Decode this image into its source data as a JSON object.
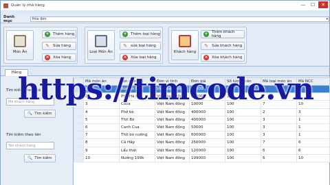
{
  "window": {
    "title": "Quản lý nhà hàng",
    "min": "—",
    "max": "☐",
    "close": "✕"
  },
  "menu": {
    "label": "Danh mục",
    "combo_value": "Hóa đơn",
    "combo_arrow": "▾"
  },
  "ribbon": {
    "groups": [
      {
        "big": "Món Ăn",
        "buttons": [
          "Thêm hàng",
          "Sửa hàng",
          "Xóa hàng"
        ]
      },
      {
        "big": "Loại Món Ăn",
        "buttons": [
          "Thêm loại hàng",
          "sửa loại hàng",
          "Xóa loại hàng"
        ]
      },
      {
        "big": "Khách hàng",
        "buttons": [
          "Thêm khách hàng",
          "Sửa khách hàng",
          "Xóa khách hàng"
        ]
      }
    ],
    "icons": {
      "add": "+",
      "edit": "✎",
      "del": "×"
    }
  },
  "tab": {
    "label": "Hàng"
  },
  "left": {
    "label1": "Tìm kiếm theo mã",
    "placeholder1": "Mã khách hàng",
    "search1": "Tìm kiếm",
    "label2": "Tìm kiếm theo tên",
    "placeholder2": "Tên khách hàng",
    "search2": "Tìm kiếm"
  },
  "table": {
    "columns": [
      "Mã món ăn",
      "Tên món ăn",
      "Đơn vị tính",
      "Đơn giá",
      "Số lượng còn",
      "Mã loại món ăn",
      "Mã NCC"
    ],
    "rows": [
      [
        "1",
        "Bún bò Huế",
        "Việt Nam đồng",
        "30000",
        "100",
        "7",
        "1"
      ],
      [
        "2",
        "Phở Hà Nội",
        "Việt Nam đồng",
        "25000",
        "100",
        "7",
        "5"
      ],
      [
        "3",
        "Coca",
        "Việt Nam đồng",
        "10000",
        "100",
        "7",
        "10"
      ],
      [
        "4",
        "Phở bò",
        "Việt Nam đồng",
        "400000",
        "100",
        "2",
        "3"
      ],
      [
        "5",
        "Thịt Bò",
        "Việt Nam đồng",
        "400000",
        "100",
        "3",
        "1"
      ],
      [
        "6",
        "Canh Cua",
        "Việt Nam đồng",
        "50000",
        "100",
        "3",
        "1"
      ],
      [
        "7",
        "Thịt bò nướng",
        "Việt Nam đồng",
        "600000",
        "100",
        "3",
        "1"
      ],
      [
        "8",
        "Cá Hấp",
        "Việt Nam đồng",
        "250000",
        "100",
        "7",
        "6"
      ],
      [
        "9",
        "Lẩu thái",
        "Việt Nam đồng",
        "120000",
        "100",
        "6",
        "6"
      ],
      [
        "10",
        "Nướng 199k",
        "Việt Nam đồng",
        "199000",
        "100",
        "6",
        "10"
      ]
    ]
  },
  "watermark": "https://timcode.vn",
  "colors": {
    "selected_row": "#3b7fd6",
    "watermark": "#1a1aa0"
  }
}
